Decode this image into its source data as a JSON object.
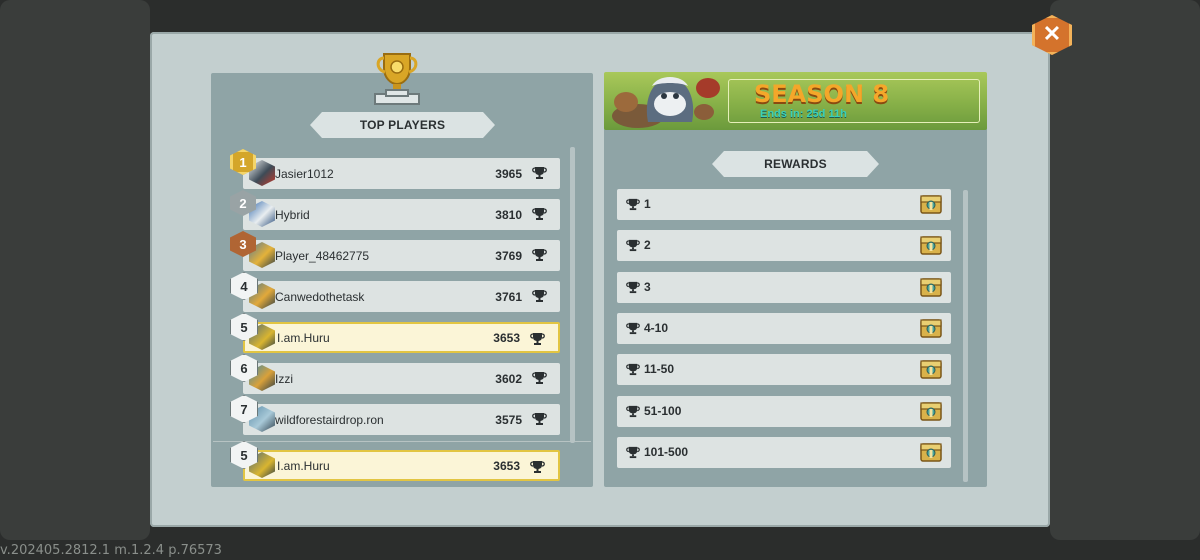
{
  "version_text": "v.202405.2812.1 m.1.2.4 p.76573",
  "top_players": {
    "title": "TOP PLAYERS",
    "players": [
      {
        "rank": "1",
        "name": "Jasier1012",
        "score": "3965",
        "badge": "gold"
      },
      {
        "rank": "2",
        "name": "Hybrid",
        "score": "3810",
        "badge": "silver"
      },
      {
        "rank": "3",
        "name": "Player_48462775",
        "score": "3769",
        "badge": "bronze"
      },
      {
        "rank": "4",
        "name": "Canwedothetask",
        "score": "3761",
        "badge": "plain"
      },
      {
        "rank": "5",
        "name": "I.am.Huru",
        "score": "3653",
        "badge": "plain"
      },
      {
        "rank": "6",
        "name": "Izzi",
        "score": "3602",
        "badge": "plain"
      },
      {
        "rank": "7",
        "name": "wildforestairdrop.ron",
        "score": "3575",
        "badge": "plain"
      }
    ],
    "current_player": {
      "rank": "5",
      "name": "I.am.Huru",
      "score": "3653"
    }
  },
  "season": {
    "title": "SEASON 8",
    "ends_in": "Ends in: 25d 11h"
  },
  "rewards": {
    "title": "REWARDS",
    "tiers": [
      "1",
      "2",
      "3",
      "4-10",
      "11-50",
      "51-100",
      "101-500"
    ]
  },
  "colors": {
    "highlight_row": "#fbf5d7",
    "highlight_border": "#e2c542",
    "close_button": "#d4732c",
    "season_title": "#f4a72a",
    "season_subtitle": "#3ad0b8"
  },
  "icons": {
    "close": "close-icon",
    "trophy": "trophy-icon",
    "cup": "cup-icon",
    "chest": "chest-icon"
  }
}
